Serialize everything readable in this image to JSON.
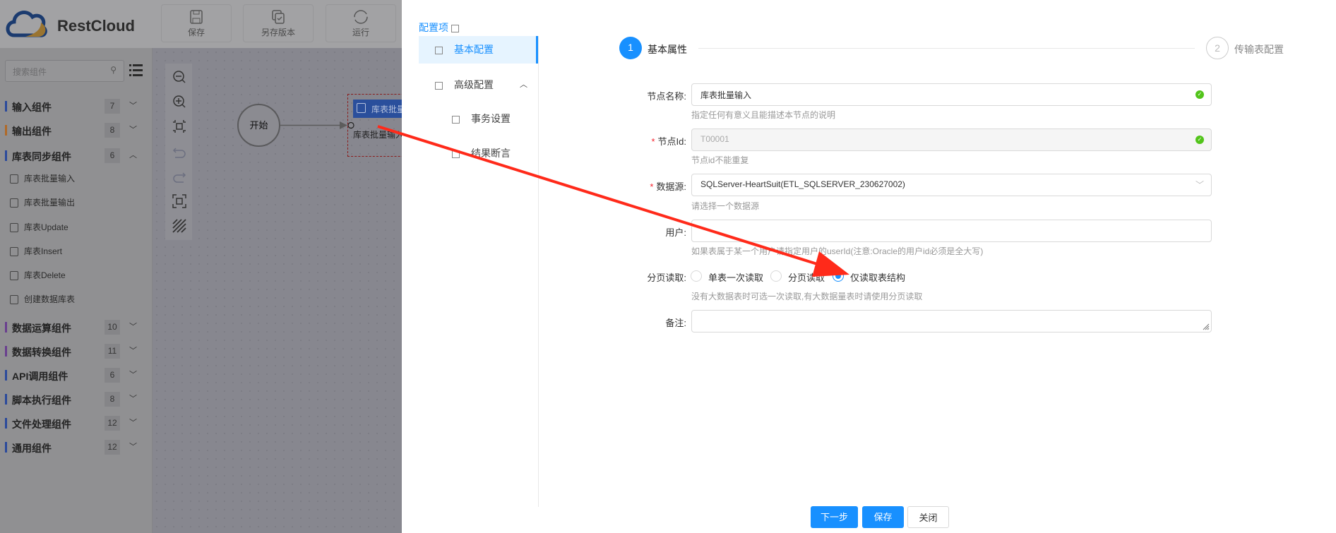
{
  "app": {
    "logo_text": "RestCloud"
  },
  "toolbar": {
    "save": "保存",
    "save_version": "另存版本",
    "run": "运行"
  },
  "sidebar": {
    "search_placeholder": "搜索组件",
    "groups": [
      {
        "label": "输入组件",
        "count": "7",
        "color": "#2b4a9c",
        "expanded": false
      },
      {
        "label": "输出组件",
        "count": "8",
        "color": "#b06a28",
        "expanded": false
      },
      {
        "label": "库表同步组件",
        "count": "6",
        "color": "#2b4a9c",
        "expanded": true
      },
      {
        "label": "数据运算组件",
        "count": "10",
        "color": "#6a3f8f",
        "expanded": false
      },
      {
        "label": "数据转换组件",
        "count": "11",
        "color": "#6a3f8f",
        "expanded": false
      },
      {
        "label": "API调用组件",
        "count": "6",
        "color": "#2b4a9c",
        "expanded": false
      },
      {
        "label": "脚本执行组件",
        "count": "8",
        "color": "#2b4a9c",
        "expanded": false
      },
      {
        "label": "文件处理组件",
        "count": "12",
        "color": "#2b4a9c",
        "expanded": false
      },
      {
        "label": "通用组件",
        "count": "12",
        "color": "#2b4a9c",
        "expanded": false
      }
    ],
    "sync_items": [
      "库表批量输入",
      "库表批量输出",
      "库表Update",
      "库表Insert",
      "库表Delete",
      "创建数据库表"
    ]
  },
  "canvas": {
    "start_label": "开始",
    "node_title": "库表批量输入",
    "node_body": "库表批量输入"
  },
  "panel": {
    "config_title": "配置项",
    "menu": {
      "basic": "基本配置",
      "advanced": "高级配置",
      "transaction": "事务设置",
      "assert": "结果断言"
    },
    "steps": [
      {
        "num": "1",
        "label": "基本属性",
        "active": true
      },
      {
        "num": "2",
        "label": "传输表配置",
        "active": false
      }
    ],
    "form": {
      "node_name": {
        "label": "节点名称:",
        "value": "库表批量输入",
        "hint": "指定任何有意义且能描述本节点的说明"
      },
      "node_id": {
        "label": "节点Id:",
        "value": "T00001",
        "hint": "节点id不能重复",
        "required": true
      },
      "datasource": {
        "label": "数据源:",
        "value": "SQLServer-HeartSuit(ETL_SQLSERVER_230627002)",
        "hint": "请选择一个数据源",
        "required": true
      },
      "user": {
        "label": "用户:",
        "value": "",
        "hint": "如果表属于某一个用户请指定用户的userId(注意:Oracle的用户id必须是全大写)"
      },
      "paging": {
        "label": "分页读取:",
        "options": [
          "单表一次读取",
          "分页读取",
          "仅读取表结构"
        ],
        "selected": "仅读取表结构",
        "hint": "没有大数据表时可选一次读取,有大数据量表时请使用分页读取"
      },
      "remark": {
        "label": "备注:",
        "value": ""
      }
    },
    "buttons": {
      "next": "下一步",
      "save": "保存",
      "close": "关闭"
    }
  },
  "colors": {
    "accent": "#1890ff",
    "success": "#52c41a",
    "annotation_arrow": "#ff2a1a"
  }
}
